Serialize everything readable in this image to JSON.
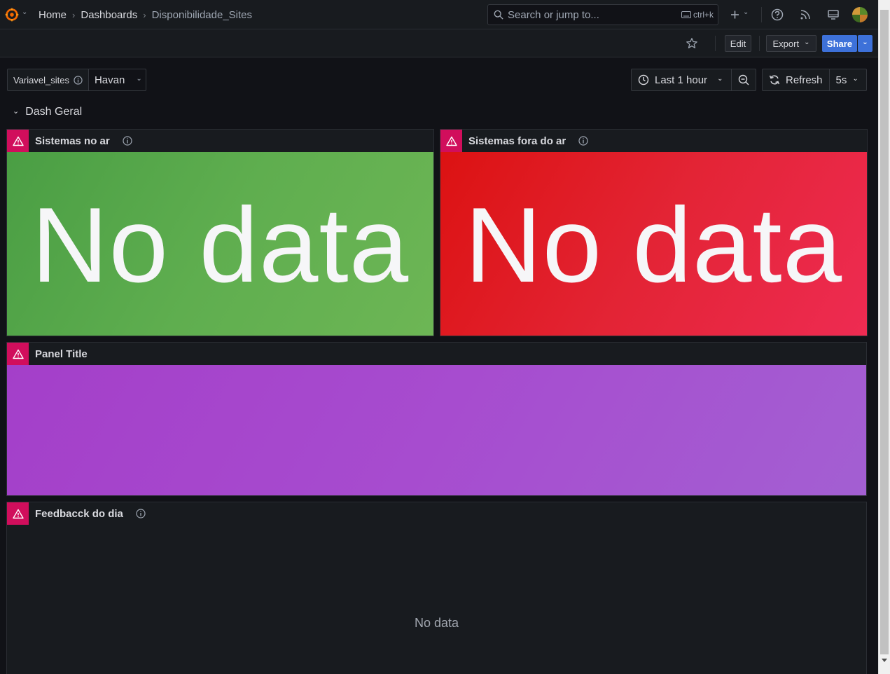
{
  "topbar": {
    "breadcrumb": [
      "Home",
      "Dashboards",
      "Disponibilidade_Sites"
    ],
    "search_placeholder": "Search or jump to...",
    "search_shortcut": "ctrl+k",
    "icons": [
      "grafana-logo-icon",
      "plus-icon",
      "help-icon",
      "rss-icon",
      "monitor-icon",
      "avatar"
    ]
  },
  "toolbar": {
    "edit_label": "Edit",
    "export_label": "Export",
    "share_label": "Share"
  },
  "variables": {
    "name": "Variavel_sites",
    "value": "Havan"
  },
  "time_range": {
    "label": "Last 1 hour",
    "refresh_label": "Refresh",
    "refresh_interval": "5s"
  },
  "row": {
    "title": "Dash Geral"
  },
  "panels": [
    {
      "title": "Sistemas no ar",
      "value": "No data",
      "color": "#56a64b"
    },
    {
      "title": "Sistemas fora do ar",
      "value": "No data",
      "color": "#e02f44"
    },
    {
      "title": "Panel Title",
      "value": "",
      "color": "#a352cc"
    },
    {
      "title": "Feedbacck do dia",
      "value": "No data",
      "color": "#181b1f"
    }
  ]
}
